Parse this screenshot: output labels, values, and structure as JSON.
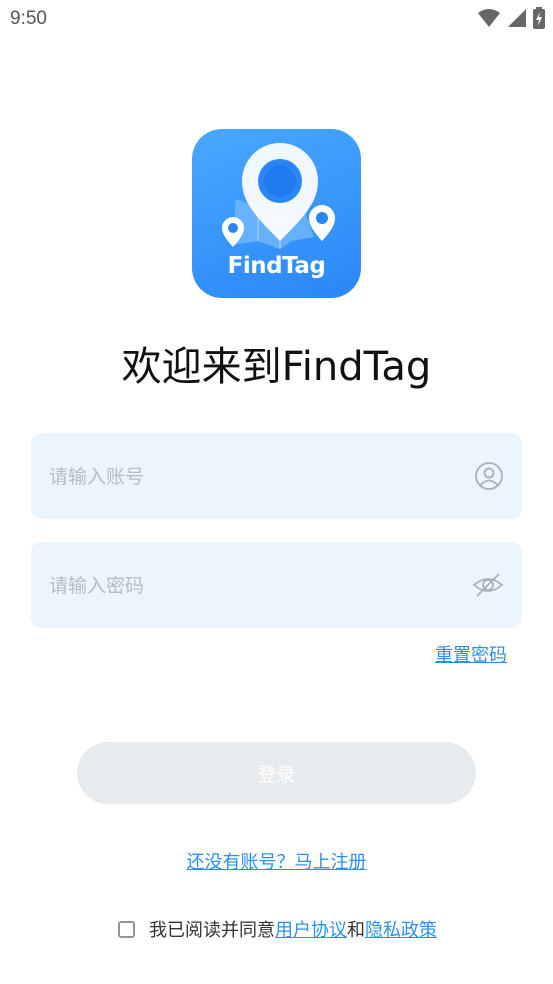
{
  "status_bar": {
    "time": "9:50",
    "icons": [
      "wifi-icon",
      "signal-icon",
      "battery-charging-icon"
    ]
  },
  "logo": {
    "text": "FindTag",
    "icon": "map-pin-logo",
    "colors": {
      "gradient_start": "#4aa8ff",
      "gradient_end": "#2a86f7"
    }
  },
  "welcome": {
    "title": "欢迎来到FindTag"
  },
  "form": {
    "account": {
      "placeholder": "请输入账号",
      "value": "",
      "icon": "user-icon"
    },
    "password": {
      "placeholder": "请输入密码",
      "value": "",
      "icon": "eye-off-icon"
    },
    "reset_password": "重置密码",
    "login_button": "登录"
  },
  "register": {
    "text": "还没有账号？马上注册"
  },
  "agreement": {
    "checked": false,
    "prefix": "我已阅读并同意",
    "user_agreement": "用户协议",
    "conjunction": "和",
    "privacy_policy": "隐私政策"
  },
  "colors": {
    "accent": "#2b8ff2",
    "input_bg": "#ebf5fe",
    "button_disabled": "#e8ebee"
  }
}
